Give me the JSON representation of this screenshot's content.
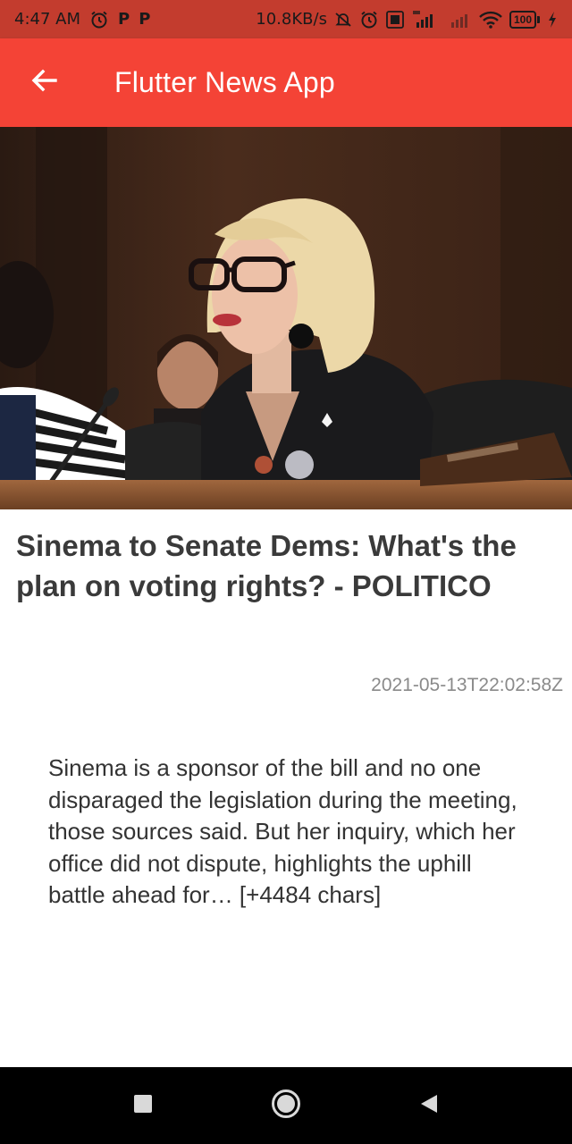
{
  "status_bar": {
    "time": "4:47 AM",
    "left_letters": [
      "P",
      "P"
    ],
    "net_speed": "10.8KB/s",
    "battery": "100"
  },
  "app_bar": {
    "title": "Flutter News App",
    "back_icon": "arrow-back-icon",
    "background_color": "#f44336"
  },
  "article": {
    "title": "Sinema to Senate Dems: What's the plan on voting rights? - POLITICO",
    "published_at": "2021-05-13T22:02:58Z",
    "content": "Sinema is a sponsor of the bill and no one disparaged the legislation during the meeting, those sources said. But her inquiry, which her office did not dispute, highlights the uphill battle ahead for… [+4484 chars]"
  },
  "nav_bar": {
    "buttons": [
      "recents-square-icon",
      "home-circle-icon",
      "back-triangle-icon"
    ]
  }
}
